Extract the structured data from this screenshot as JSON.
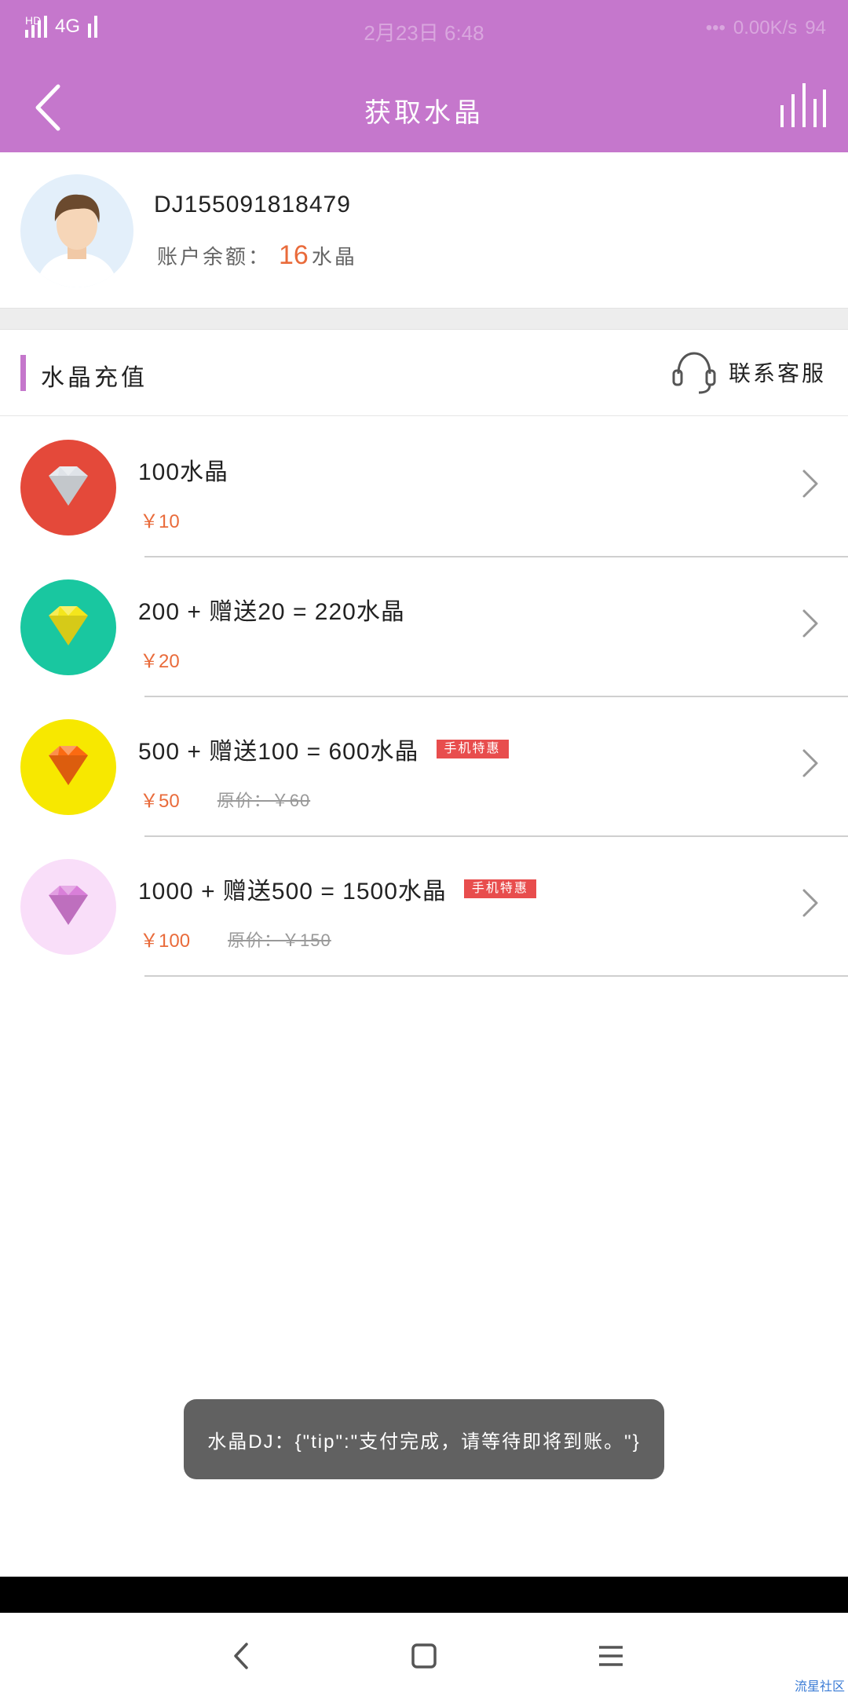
{
  "status_bar": {
    "network": "4G",
    "hd_label": "HD",
    "center_time": "2月23日  6:48",
    "net_speed": "0.00K/s",
    "battery": "94"
  },
  "header": {
    "title": "获取水晶"
  },
  "profile": {
    "user_id": "DJ155091818479",
    "balance_label": "账户余额：",
    "balance_value": "16",
    "balance_unit": "水晶"
  },
  "section": {
    "title": "水晶充值",
    "contact_label": "联系客服"
  },
  "items": [
    {
      "title": "100水晶",
      "price": "￥10",
      "original_price": "",
      "badge": "",
      "color": "#e4493a",
      "gem": "#dfe3e8"
    },
    {
      "title": "200 + 赠送20 = 220水晶",
      "price": "￥20",
      "original_price": "",
      "badge": "",
      "color": "#19c7a0",
      "gem": "#f4e61c"
    },
    {
      "title": "500 + 赠送100 = 600水晶",
      "price": "￥50",
      "original_price": "原价：￥60",
      "badge": "手机特惠",
      "color": "#f7e800",
      "gem": "#fb6a11"
    },
    {
      "title": "1000 + 赠送500 = 1500水晶",
      "price": "￥100",
      "original_price": "原价：￥150",
      "badge": "手机特惠",
      "color": "#f9def9",
      "gem": "#d97fd9"
    }
  ],
  "toast": {
    "message": "水晶DJ：{\"tip\":\"支付完成，请等待即将到账。\"}"
  },
  "watermark": "流星社区",
  "colors": {
    "brand": "#c577cc",
    "price": "#e96b3b",
    "badge": "#e84d4d"
  }
}
